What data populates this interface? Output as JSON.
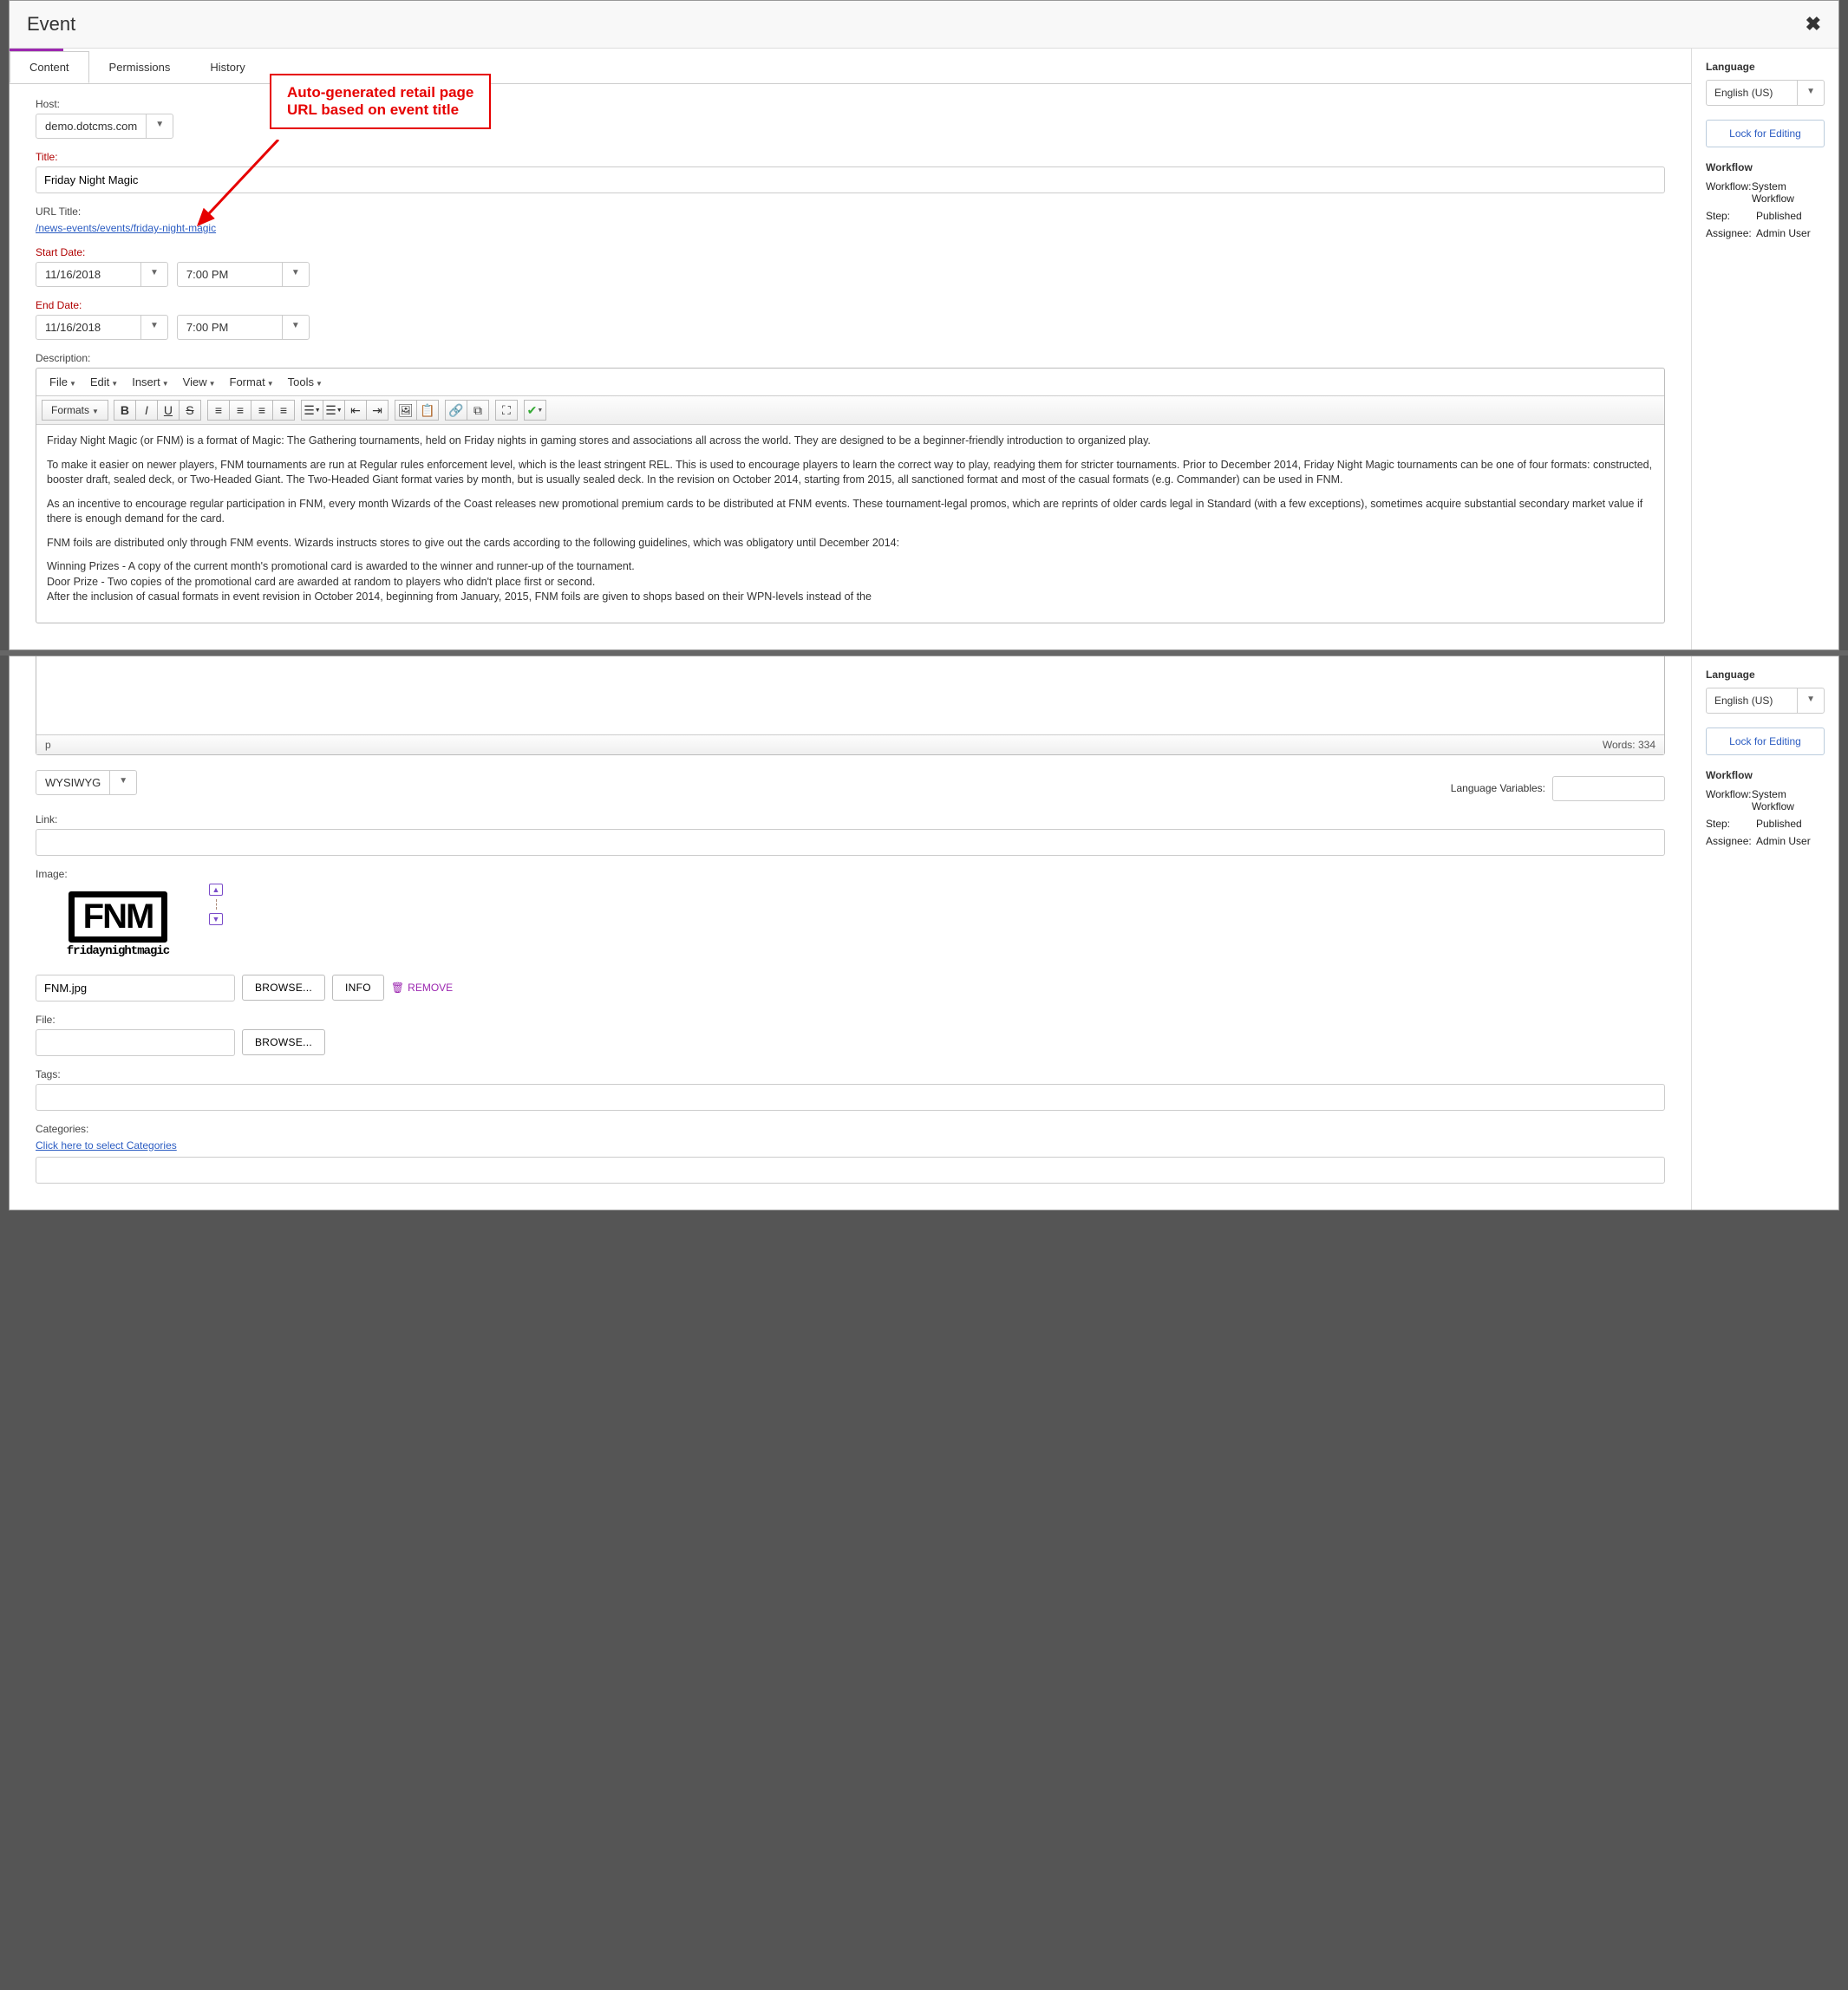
{
  "dialog": {
    "title": "Event"
  },
  "tabs": [
    "Content",
    "Permissions",
    "History"
  ],
  "annotation": {
    "line1": "Auto-generated retail page",
    "line2": "URL based on event title"
  },
  "form": {
    "host_label": "Host:",
    "host_value": "demo.dotcms.com",
    "title_label": "Title:",
    "title_value": "Friday Night Magic",
    "url_title_label": "URL Title:",
    "url_title_value": "/news-events/events/friday-night-magic",
    "start_date_label": "Start Date:",
    "start_date": "11/16/2018",
    "start_time": "7:00 PM",
    "end_date_label": "End Date:",
    "end_date": "11/16/2018",
    "end_time": "7:00 PM",
    "description_label": "Description:"
  },
  "editor": {
    "menus": [
      "File",
      "Edit",
      "Insert",
      "View",
      "Format",
      "Tools"
    ],
    "formats_label": "Formats",
    "paragraphs": [
      "Friday Night Magic (or FNM) is a format of Magic: The Gathering tournaments, held on Friday nights in gaming stores and associations all across the world. They are designed to be a beginner-friendly introduction to organized play.",
      "To make it easier on newer players, FNM tournaments are run at Regular rules enforcement level, which is the least stringent REL. This is used to encourage players to learn the correct way to play, readying them for stricter tournaments. Prior to December 2014, Friday Night Magic tournaments can be one of four formats: constructed, booster draft, sealed deck, or Two-Headed Giant. The Two-Headed Giant format varies by month, but is usually sealed deck. In the revision on October 2014, starting from 2015, all sanctioned format and most of the casual formats (e.g. Commander) can be used in FNM.",
      "As an incentive to encourage regular participation in FNM, every month Wizards of the Coast releases new promotional premium cards to be distributed at FNM events. These tournament-legal promos, which are reprints of older cards legal in Standard (with a few exceptions), sometimes acquire substantial secondary market value if there is enough demand for the card.",
      "FNM foils are distributed only through FNM events. Wizards instructs stores to give out the cards according to the following guidelines, which was obligatory until December 2014:",
      "Winning Prizes - A copy of the current month's promotional card is awarded to the winner and runner-up of the tournament.\nDoor Prize - Two copies of the promotional card are awarded at random to players who didn't place first or second.\nAfter the inclusion of casual formats in event revision in October 2014, beginning from January, 2015, FNM foils are given to shops based on their WPN-levels instead of the"
    ],
    "status_path": "p",
    "word_count": "Words: 334"
  },
  "lower": {
    "mode_value": "WYSIWYG",
    "lang_vars_label": "Language Variables:",
    "link_label": "Link:",
    "link_value": "",
    "image_label": "Image:",
    "image_filename": "FNM.jpg",
    "browse_label": "BROWSE...",
    "info_label": "INFO",
    "remove_label": "REMOVE",
    "file_label": "File:",
    "file_value": "",
    "tags_label": "Tags:",
    "tags_value": "",
    "categories_label": "Categories:",
    "categories_link": "Click here to select Categories",
    "thumb_main": "FNM",
    "thumb_sub": "fridaynightmagic"
  },
  "sidebar": {
    "language_label": "Language",
    "language_value": "English (US)",
    "lock_label": "Lock for Editing",
    "workflow_heading": "Workflow",
    "rows": [
      {
        "k": "Workflow:",
        "v": "System Workflow"
      },
      {
        "k": "Step:",
        "v": "Published"
      },
      {
        "k": "Assignee:",
        "v": "Admin User"
      }
    ]
  }
}
